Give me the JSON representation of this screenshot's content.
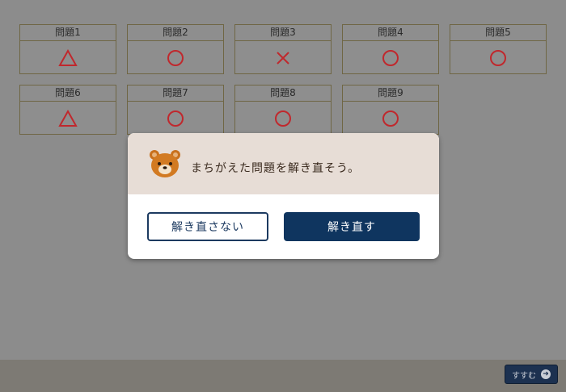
{
  "problems": [
    {
      "label": "問題1",
      "mark": "triangle"
    },
    {
      "label": "問題2",
      "mark": "circle"
    },
    {
      "label": "問題3",
      "mark": "cross"
    },
    {
      "label": "問題4",
      "mark": "circle"
    },
    {
      "label": "問題5",
      "mark": "circle"
    },
    {
      "label": "問題6",
      "mark": "triangle"
    },
    {
      "label": "問題7",
      "mark": "circle"
    },
    {
      "label": "問題8",
      "mark": "circle"
    },
    {
      "label": "問題9",
      "mark": "circle"
    }
  ],
  "dialog": {
    "message": "まちがえた問題を解き直そう。",
    "no_retry_label": "解き直さない",
    "retry_label": "解き直す"
  },
  "footer": {
    "next_label": "すすむ"
  },
  "colors": {
    "mark": "#c0282d",
    "primary": "#0f355f",
    "dialog_header": "#e7ddd6"
  }
}
